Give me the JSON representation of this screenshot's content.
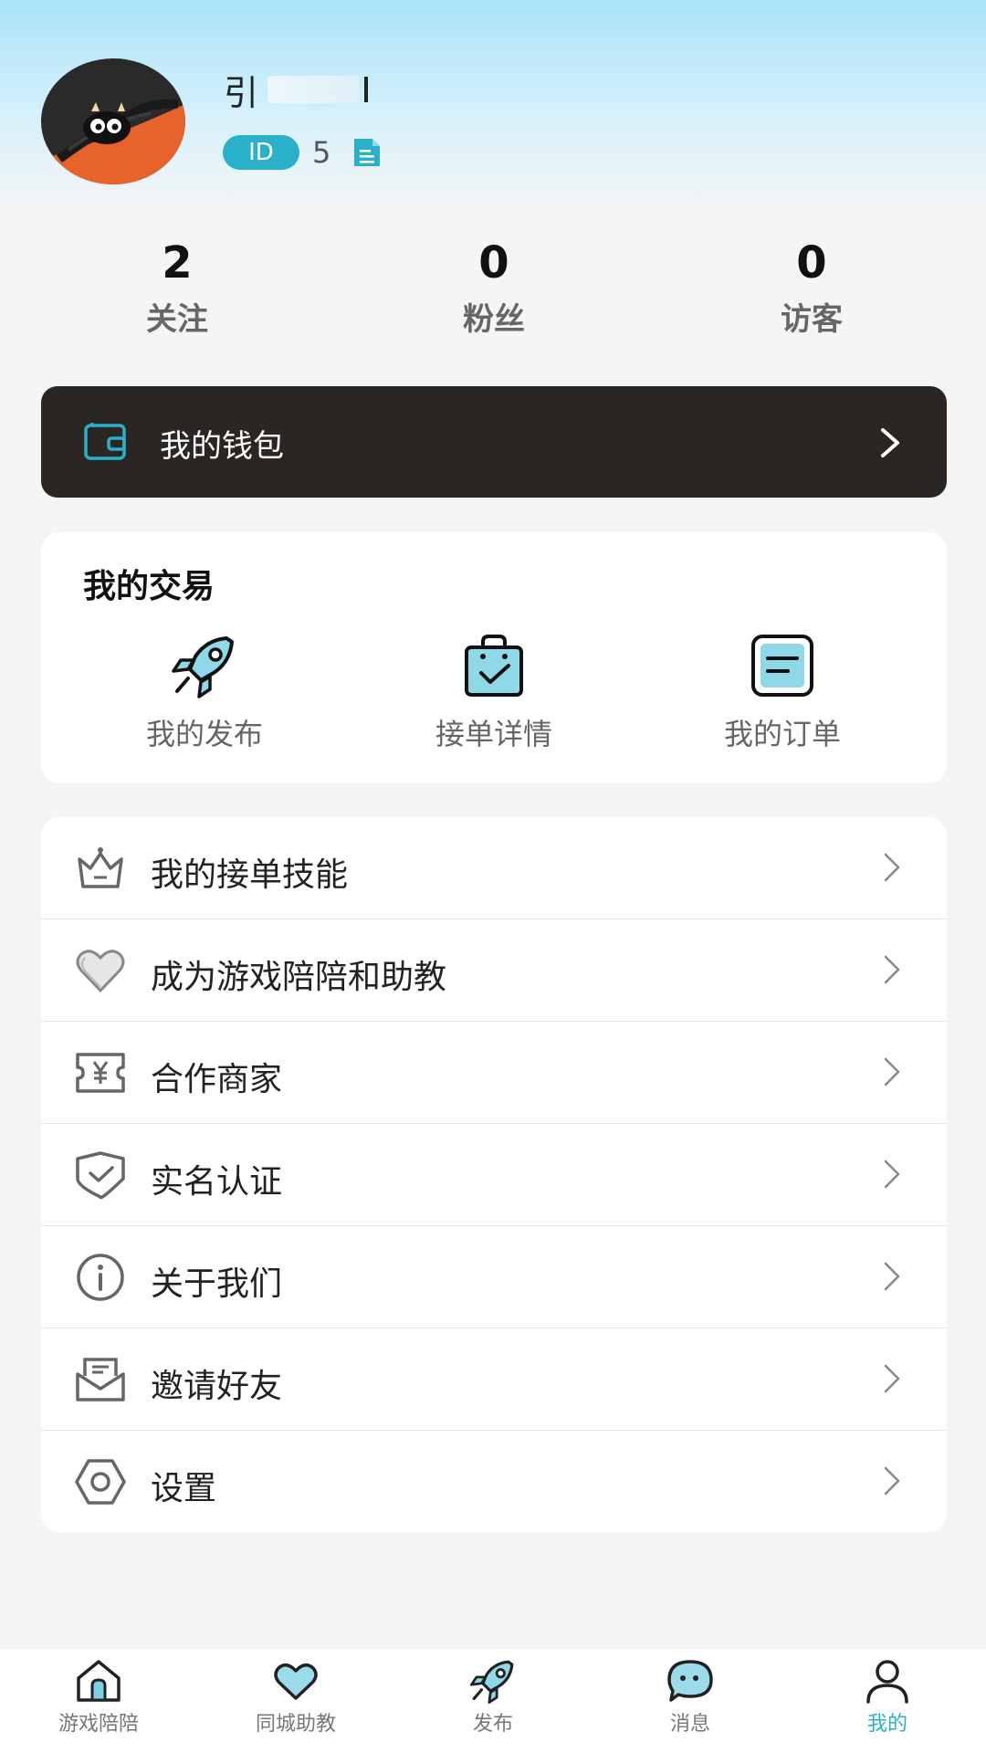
{
  "profile": {
    "username_visible": "引",
    "id_badge": "ID",
    "id_value": "5"
  },
  "stats": [
    {
      "value": "2",
      "label": "关注"
    },
    {
      "value": "0",
      "label": "粉丝"
    },
    {
      "value": "0",
      "label": "访客"
    }
  ],
  "wallet": {
    "label": "我的钱包"
  },
  "trade": {
    "title": "我的交易",
    "items": [
      {
        "label": "我的发布",
        "icon": "rocket-icon"
      },
      {
        "label": "接单详情",
        "icon": "shopping-bag-icon"
      },
      {
        "label": "我的订单",
        "icon": "order-list-icon"
      }
    ]
  },
  "menu": [
    {
      "label": "我的接单技能",
      "icon": "crown-icon"
    },
    {
      "label": "成为游戏陪陪和助教",
      "icon": "heart-icon"
    },
    {
      "label": "合作商家",
      "icon": "yen-ticket-icon"
    },
    {
      "label": "实名认证",
      "icon": "shield-check-icon"
    },
    {
      "label": "关于我们",
      "icon": "info-icon"
    },
    {
      "label": "邀请好友",
      "icon": "mail-icon"
    },
    {
      "label": "设置",
      "icon": "settings-hexagon-icon"
    }
  ],
  "nav": [
    {
      "label": "游戏陪陪",
      "icon": "home-icon"
    },
    {
      "label": "同城助教",
      "icon": "heart-icon"
    },
    {
      "label": "发布",
      "icon": "rocket-icon"
    },
    {
      "label": "消息",
      "icon": "chat-bubble-icon"
    },
    {
      "label": "我的",
      "icon": "user-icon",
      "active": true
    }
  ],
  "colors": {
    "accent": "#2bb0c9",
    "wallet_bg": "#2a2624",
    "icon_fill": "#7fd0e2"
  }
}
